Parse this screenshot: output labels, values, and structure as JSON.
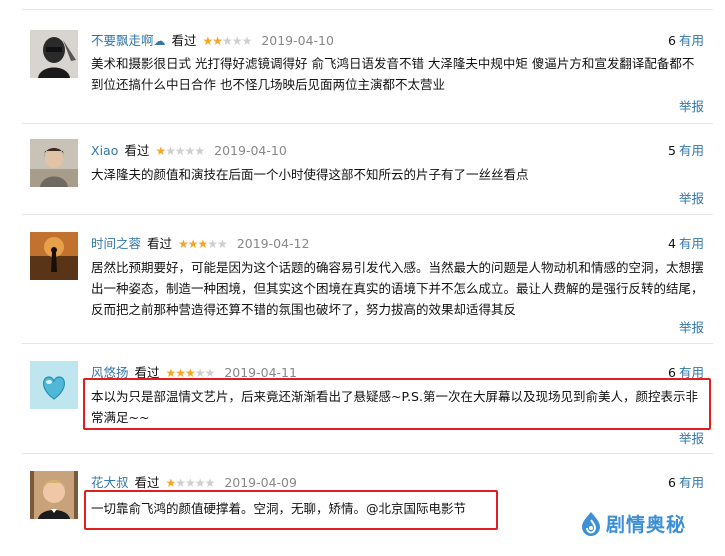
{
  "comments": [
    {
      "user": "不要飘走啊",
      "status": "看过",
      "stars": 2,
      "date": "2019-04-10",
      "votes": "6",
      "useful_label": "有用",
      "text": "美术和摄影很日式 光打得好滤镜调得好 俞飞鸿日语发音不错 大泽隆夫中规中矩 傻逼片方和宣发翻译配备都不到位还搞什么中日合作 也不怪几场映后见面两位主演都不太营业",
      "report_label": "举报"
    },
    {
      "user": "Xiao",
      "status": "看过",
      "stars": 1,
      "date": "2019-04-10",
      "votes": "5",
      "useful_label": "有用",
      "text": "大泽隆夫的颜值和演技在后面一个小时使得这部不知所云的片子有了一丝丝看点",
      "report_label": "举报"
    },
    {
      "user": "时间之蓉",
      "status": "看过",
      "stars": 3,
      "date": "2019-04-12",
      "votes": "4",
      "useful_label": "有用",
      "text": "居然比预期要好，可能是因为这个话题的确容易引发代入感。当然最大的问题是人物动机和情感的空洞，太想摆出一种姿态，制造一种困境，但其实这个困境在真实的语境下并不怎么成立。最让人费解的是强行反转的结尾，反而把之前那种营造得还算不错的氛围也破坏了，努力拔高的效果却适得其反",
      "report_label": "举报"
    },
    {
      "user": "风悠扬",
      "status": "看过",
      "stars": 3,
      "date": "2019-04-11",
      "votes": "6",
      "useful_label": "有用",
      "text": "本以为只是部温情文艺片，后来竟还渐渐看出了悬疑感~P.S.第一次在大屏幕以及现场见到俞美人，颜控表示非常满足~~",
      "report_label": "举报"
    },
    {
      "user": "花大叔",
      "status": "看过",
      "stars": 1,
      "date": "2019-04-09",
      "votes": "6",
      "useful_label": "有用",
      "text": "一切靠俞飞鸿的颜值硬撑着。空洞，无聊，矫情。@北京国际电影节",
      "report_label": ""
    }
  ],
  "star_glyph": "★",
  "watermark": {
    "text": "剧情奥秘",
    "color": "#3d8fd6"
  },
  "colors": {
    "link": "#3377aa",
    "star": "#f5a623",
    "highlight": "#e02020"
  }
}
